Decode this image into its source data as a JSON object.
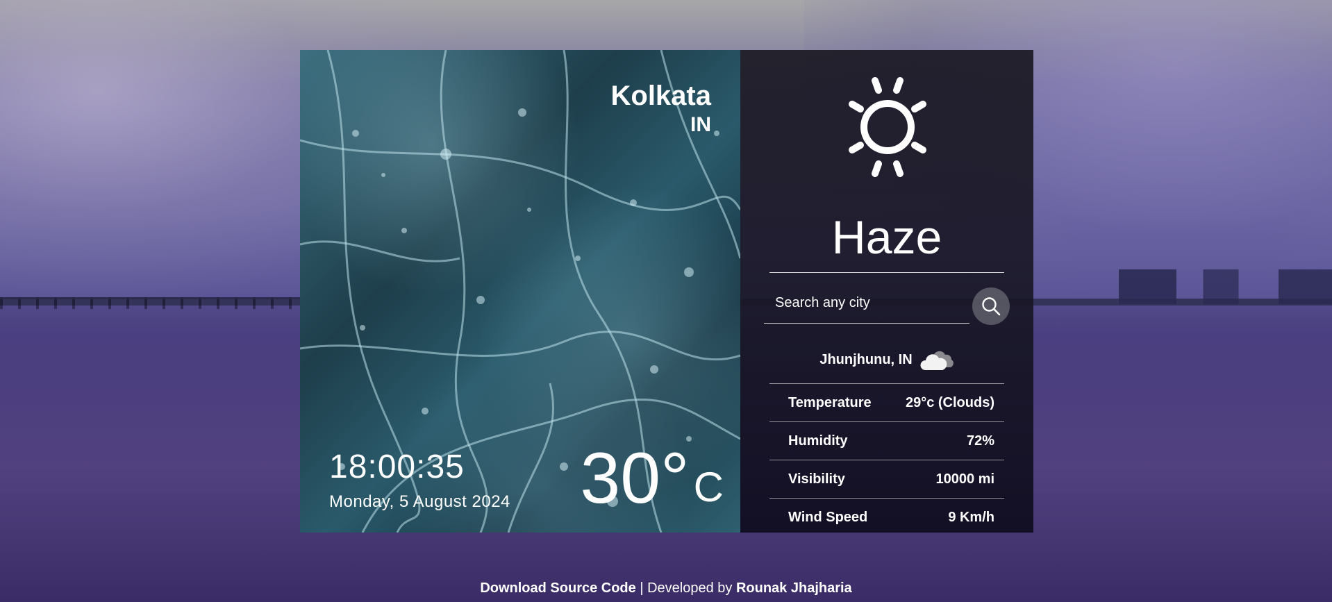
{
  "location": {
    "city": "Kolkata",
    "country": "IN"
  },
  "time": {
    "clock": "18:00:35",
    "date": "Monday, 5 August 2024"
  },
  "current": {
    "temperature": "30°",
    "unit": "C",
    "condition": "Haze",
    "icon": "sun-icon"
  },
  "search": {
    "placeholder": "Search any city",
    "value": ""
  },
  "result": {
    "location": "Jhunjhunu, IN",
    "icon": "cloud-icon",
    "stats": [
      {
        "label": "Temperature",
        "value": "29°c (Clouds)"
      },
      {
        "label": "Humidity",
        "value": "72%"
      },
      {
        "label": "Visibility",
        "value": "10000 mi"
      },
      {
        "label": "Wind Speed",
        "value": "9 Km/h"
      }
    ]
  },
  "footer": {
    "link_text": "Download Source Code",
    "separator": " | Developed by ",
    "author": "Rounak Jhajharia"
  }
}
